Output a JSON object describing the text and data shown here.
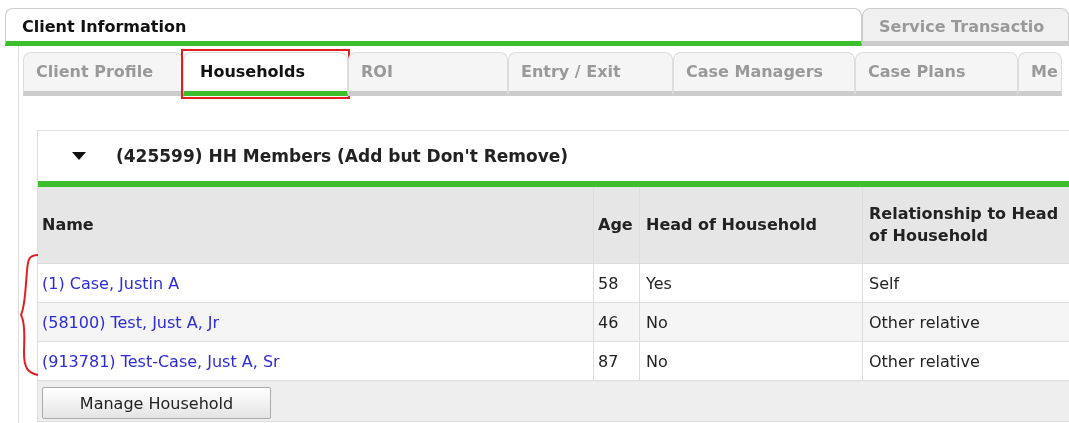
{
  "top_tabs": [
    {
      "label": "Client Information",
      "selected": true
    },
    {
      "label": "Service Transactio",
      "selected": false
    }
  ],
  "sub_tabs": [
    {
      "label": "Client Profile",
      "selected": false
    },
    {
      "label": "Households",
      "selected": true,
      "highlighted": true
    },
    {
      "label": "ROI",
      "selected": false
    },
    {
      "label": "Entry / Exit",
      "selected": false
    },
    {
      "label": "Case Managers",
      "selected": false
    },
    {
      "label": "Case Plans",
      "selected": false
    },
    {
      "label": "Me",
      "selected": false
    }
  ],
  "section": {
    "title": "(425599) HH Members (Add but Don't Remove)",
    "expanded": true
  },
  "table": {
    "columns": [
      "Name",
      "Age",
      "Head of Household",
      "Relationship to Head of Household"
    ],
    "rows": [
      {
        "name": "(1) Case, Justin A",
        "age": "58",
        "head": "Yes",
        "relationship": "Self"
      },
      {
        "name": "(58100) Test, Just A, Jr",
        "age": "46",
        "head": "No",
        "relationship": "Other relative"
      },
      {
        "name": "(913781) Test-Case, Just A, Sr",
        "age": "87",
        "head": "No",
        "relationship": "Other relative"
      }
    ]
  },
  "buttons": [
    "Manage Household"
  ]
}
